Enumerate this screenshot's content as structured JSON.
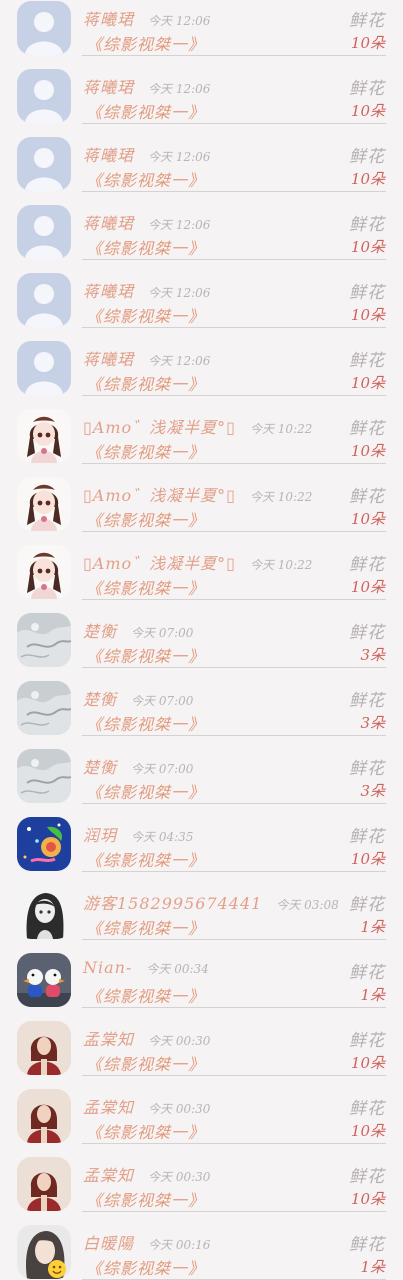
{
  "rows": [
    {
      "name": "蒋曦珺",
      "time": "今天 12:06",
      "message": "《综影视桀一》",
      "gift": "鲜花",
      "count": "10朵",
      "avatar": "default-person"
    },
    {
      "name": "蒋曦珺",
      "time": "今天 12:06",
      "message": "《综影视桀一》",
      "gift": "鲜花",
      "count": "10朵",
      "avatar": "default-person"
    },
    {
      "name": "蒋曦珺",
      "time": "今天 12:06",
      "message": "《综影视桀一》",
      "gift": "鲜花",
      "count": "10朵",
      "avatar": "default-person"
    },
    {
      "name": "蒋曦珺",
      "time": "今天 12:06",
      "message": "《综影视桀一》",
      "gift": "鲜花",
      "count": "10朵",
      "avatar": "default-person"
    },
    {
      "name": "蒋曦珺",
      "time": "今天 12:06",
      "message": "《综影视桀一》",
      "gift": "鲜花",
      "count": "10朵",
      "avatar": "default-person"
    },
    {
      "name": "蒋曦珺",
      "time": "今天 12:06",
      "message": "《综影视桀一》",
      "gift": "鲜花",
      "count": "10朵",
      "avatar": "default-person"
    },
    {
      "name": "▯Amo゛浅凝半夏°▯",
      "time": "今天 10:22",
      "message": "《综影视桀一》",
      "gift": "鲜花",
      "count": "10朵",
      "avatar": "anime-girl"
    },
    {
      "name": "▯Amo゛浅凝半夏°▯",
      "time": "今天 10:22",
      "message": "《综影视桀一》",
      "gift": "鲜花",
      "count": "10朵",
      "avatar": "anime-girl"
    },
    {
      "name": "▯Amo゛浅凝半夏°▯",
      "time": "今天 10:22",
      "message": "《综影视桀一》",
      "gift": "鲜花",
      "count": "10朵",
      "avatar": "anime-girl"
    },
    {
      "name": "楚衡",
      "time": "今天 07:00",
      "message": "《综影视桀一》",
      "gift": "鲜花",
      "count": "3朵",
      "avatar": "grey-texture"
    },
    {
      "name": "楚衡",
      "time": "今天 07:00",
      "message": "《综影视桀一》",
      "gift": "鲜花",
      "count": "3朵",
      "avatar": "grey-texture"
    },
    {
      "name": "楚衡",
      "time": "今天 07:00",
      "message": "《综影视桀一》",
      "gift": "鲜花",
      "count": "3朵",
      "avatar": "grey-texture"
    },
    {
      "name": "润玥",
      "time": "今天 04:35",
      "message": "《综影视桀一》",
      "gift": "鲜花",
      "count": "10朵",
      "avatar": "blue-cartoon"
    },
    {
      "name": "游客1582995674441",
      "time": "今天 03:08",
      "message": "《综影视桀一》",
      "gift": "鲜花",
      "count": "1朵",
      "avatar": "sketch-girl"
    },
    {
      "name": "Nian-",
      "time": "今天 00:34",
      "message": "《综影视桀一》",
      "gift": "鲜花",
      "count": "1朵",
      "avatar": "duck-toys"
    },
    {
      "name": "孟棠知",
      "time": "今天 00:30",
      "message": "《综影视桀一》",
      "gift": "鲜花",
      "count": "10朵",
      "avatar": "red-hood"
    },
    {
      "name": "孟棠知",
      "time": "今天 00:30",
      "message": "《综影视桀一》",
      "gift": "鲜花",
      "count": "10朵",
      "avatar": "red-hood"
    },
    {
      "name": "孟棠知",
      "time": "今天 00:30",
      "message": "《综影视桀一》",
      "gift": "鲜花",
      "count": "10朵",
      "avatar": "red-hood"
    },
    {
      "name": "白暖陽",
      "time": "今天 00:16",
      "message": "《综影视桀一》",
      "gift": "鲜花",
      "count": "1朵",
      "avatar": "lady-emoji"
    }
  ],
  "colors": {
    "background": "#f6f3f4",
    "name": "#e2a089",
    "message": "#e39a7c",
    "time": "#b9b4b6",
    "gift": "#b6b0b3",
    "count": "#d0625c",
    "divider": "#d6d2d3"
  }
}
